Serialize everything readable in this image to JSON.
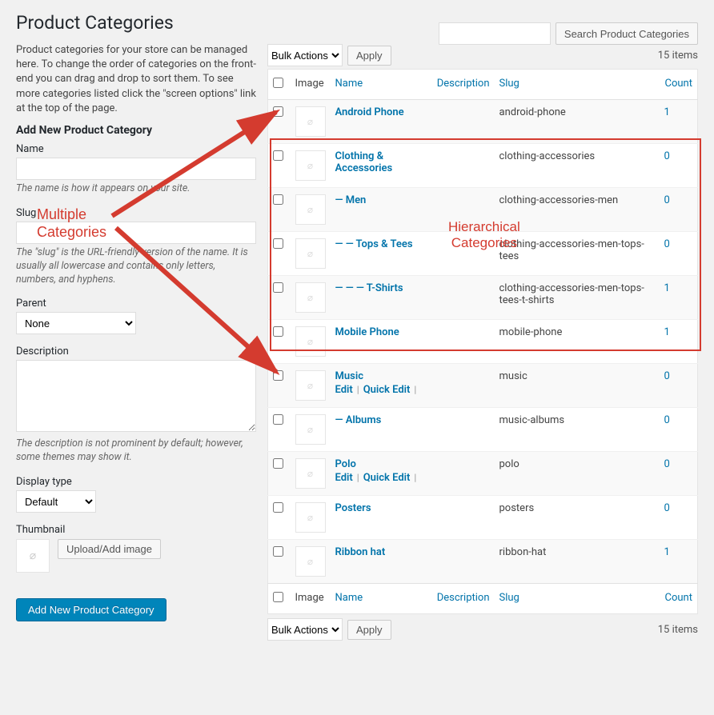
{
  "page_title": "Product Categories",
  "search": {
    "button_label": "Search Product Categories"
  },
  "intro": "Product categories for your store can be managed here. To change the order of categories on the front-end you can drag and drop to sort them. To see more categories listed click the \"screen options\" link at the top of the page.",
  "form": {
    "heading": "Add New Product Category",
    "name": {
      "label": "Name",
      "hint": "The name is how it appears on your site."
    },
    "slug": {
      "label": "Slug",
      "hint": "The \"slug\" is the URL-friendly version of the name. It is usually all lowercase and contains only letters, numbers, and hyphens."
    },
    "parent": {
      "label": "Parent",
      "value": "None"
    },
    "description": {
      "label": "Description",
      "hint": "The description is not prominent by default; however, some themes may show it."
    },
    "display_type": {
      "label": "Display type",
      "value": "Default"
    },
    "thumbnail": {
      "label": "Thumbnail",
      "upload_label": "Upload/Add image"
    },
    "submit_label": "Add New Product Category"
  },
  "bulk_actions": {
    "label": "Bulk Actions",
    "apply_label": "Apply"
  },
  "items_count_label": "15 items",
  "table": {
    "columns": {
      "image": "Image",
      "name": "Name",
      "description": "Description",
      "slug": "Slug",
      "count": "Count"
    }
  },
  "rows": [
    {
      "name": "Android Phone",
      "slug": "android-phone",
      "count": "1",
      "desc": ""
    },
    {
      "name": "Clothing & Accessories",
      "slug": "clothing-accessories",
      "count": "0",
      "desc": ""
    },
    {
      "name": "— Men",
      "slug": "clothing-accessories-men",
      "count": "0",
      "desc": ""
    },
    {
      "name": "— — Tops & Tees",
      "slug": "clothing-accessories-men-tops-tees",
      "count": "0",
      "desc": ""
    },
    {
      "name": "— — — T-Shirts",
      "slug": "clothing-accessories-men-tops-tees-t-shirts",
      "count": "1",
      "desc": ""
    },
    {
      "name": "Mobile Phone",
      "slug": "mobile-phone",
      "count": "1",
      "desc": ""
    },
    {
      "name": "Music",
      "slug": "music",
      "count": "0",
      "desc": "",
      "show_actions": true
    },
    {
      "name": "— Albums",
      "slug": "music-albums",
      "count": "0",
      "desc": ""
    },
    {
      "name": "Polo",
      "slug": "polo",
      "count": "0",
      "desc": "",
      "show_actions": true
    },
    {
      "name": "Posters",
      "slug": "posters",
      "count": "0",
      "desc": ""
    },
    {
      "name": "Ribbon hat",
      "slug": "ribbon-hat",
      "count": "1",
      "desc": ""
    }
  ],
  "row_actions": {
    "edit": "Edit",
    "quick_edit": "Quick Edit"
  },
  "annotations": {
    "multiple_label": "Multiple\nCategories",
    "hierarchical_label": "Hierarchical\nCategories"
  }
}
